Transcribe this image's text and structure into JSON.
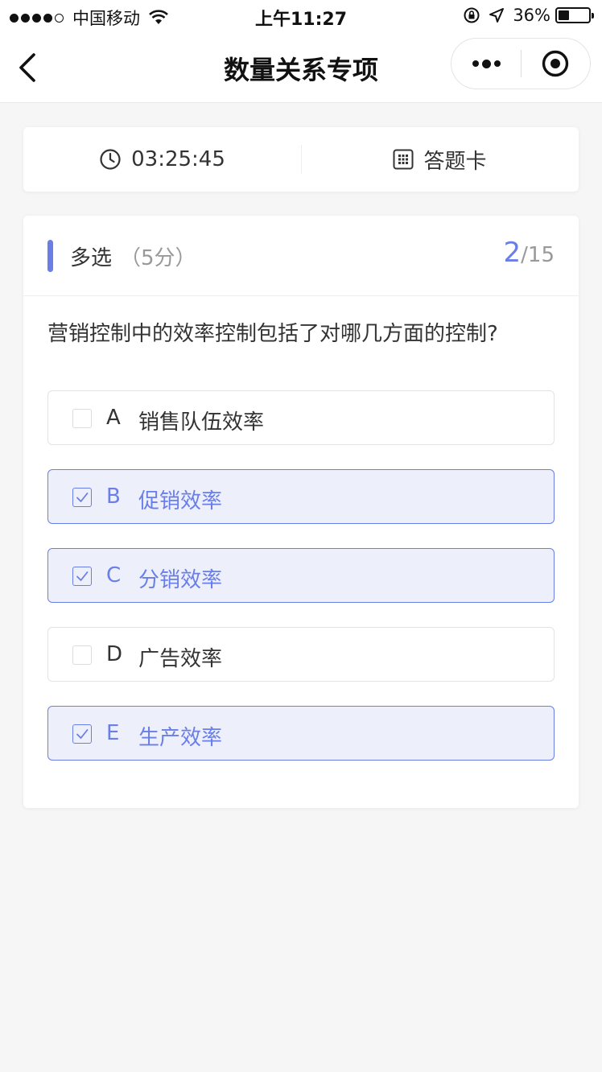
{
  "status_bar": {
    "carrier": "中国移动",
    "time": "上午11:27",
    "battery_percent": "36%",
    "battery_level": 0.36,
    "signal_bars": 4
  },
  "nav": {
    "title": "数量关系专项"
  },
  "timer": {
    "elapsed": "03:25:45",
    "answer_card_label": "答题卡"
  },
  "question": {
    "type_label": "多选",
    "score_label": "（5分）",
    "current": "2",
    "total": "/15",
    "text": "营销控制中的效率控制包括了对哪几方面的控制?",
    "options": [
      {
        "letter": "A",
        "text": "销售队伍效率",
        "selected": false
      },
      {
        "letter": "B",
        "text": "促销效率",
        "selected": true
      },
      {
        "letter": "C",
        "text": "分销效率",
        "selected": true
      },
      {
        "letter": "D",
        "text": "广告效率",
        "selected": false
      },
      {
        "letter": "E",
        "text": "生产效率",
        "selected": true
      }
    ]
  },
  "colors": {
    "accent": "#6a7ee8",
    "selected_bg": "#edf0fb",
    "page_bg": "#f6f6f6"
  }
}
